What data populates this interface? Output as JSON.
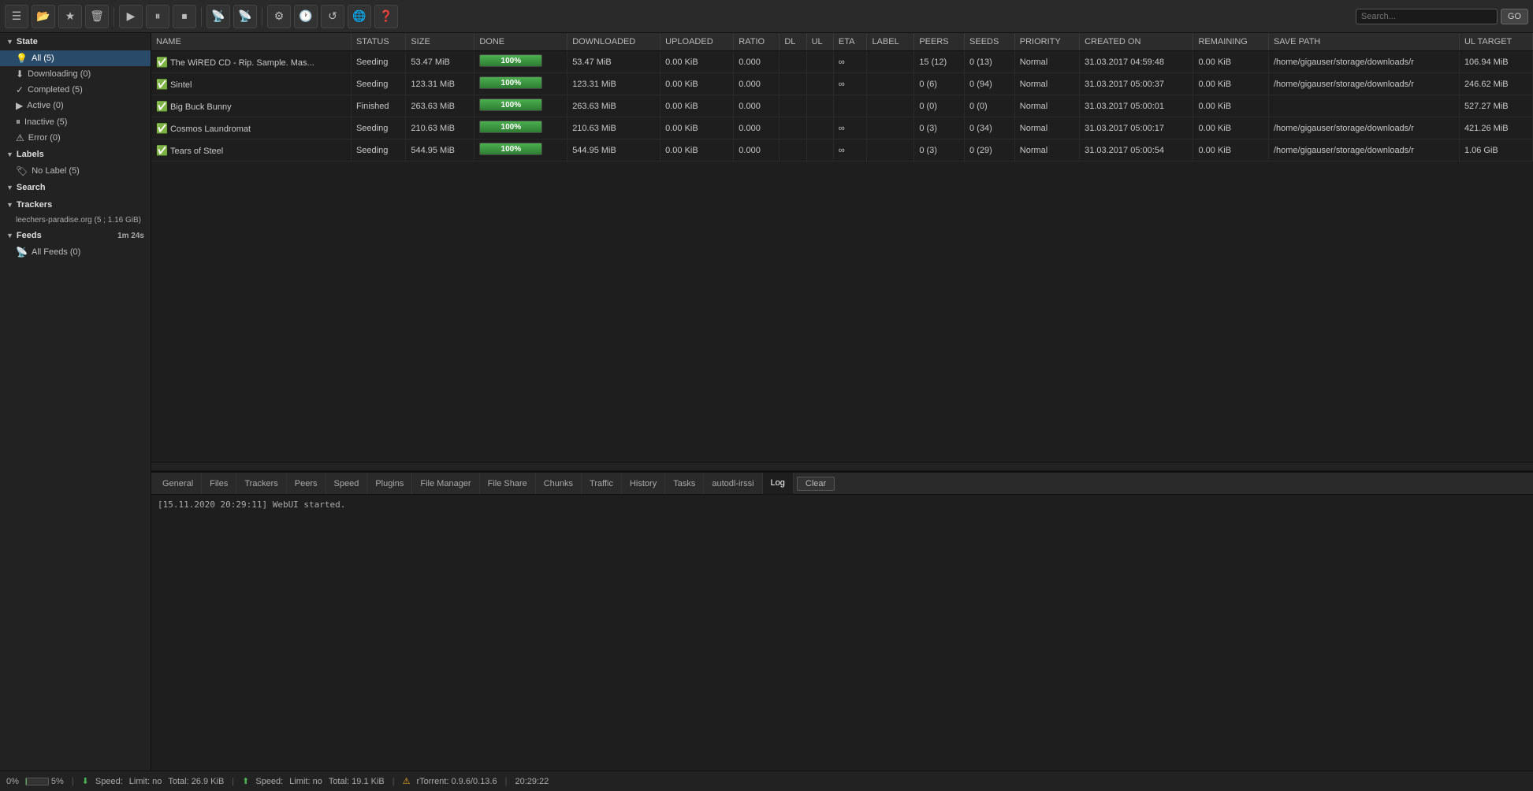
{
  "toolbar": {
    "buttons": [
      {
        "name": "menu-icon",
        "symbol": "☰"
      },
      {
        "name": "open-icon",
        "symbol": "📂"
      },
      {
        "name": "bookmark-icon",
        "symbol": "★"
      },
      {
        "name": "delete-icon",
        "symbol": "🗑"
      },
      {
        "name": "play-icon",
        "symbol": "▶"
      },
      {
        "name": "pause-icon",
        "symbol": "⏸"
      },
      {
        "name": "stop-icon",
        "symbol": "⏹"
      },
      {
        "name": "rss-icon",
        "symbol": "📡"
      },
      {
        "name": "rss2-icon",
        "symbol": "📡"
      },
      {
        "name": "settings-icon",
        "symbol": "⚙"
      },
      {
        "name": "clock-icon",
        "symbol": "🕐"
      },
      {
        "name": "refresh-icon",
        "symbol": "↺"
      },
      {
        "name": "network-icon",
        "symbol": "🌐"
      },
      {
        "name": "help-icon",
        "symbol": "❓"
      }
    ],
    "search_placeholder": "Search...",
    "go_label": "GO"
  },
  "sidebar": {
    "state_label": "State",
    "state_items": [
      {
        "label": "All (5)",
        "active": true,
        "icon": "💡"
      },
      {
        "label": "Downloading (0)",
        "icon": "⬇"
      },
      {
        "label": "Completed (5)",
        "icon": "✓"
      },
      {
        "label": "Active (0)",
        "icon": "▶"
      },
      {
        "label": "Inactive (5)",
        "icon": "⏸"
      },
      {
        "label": "Error (0)",
        "icon": "⚠"
      }
    ],
    "labels_label": "Labels",
    "label_items": [
      {
        "label": "No Label (5)",
        "icon": "🏷"
      }
    ],
    "search_label": "Search",
    "trackers_label": "Trackers",
    "tracker_items": [
      {
        "label": "leechers-paradise.org (5 ; 1.16 GiB)"
      }
    ],
    "feeds_label": "Feeds",
    "feeds_timer": "1m 24s",
    "feed_items": [
      {
        "label": "All Feeds (0)",
        "icon": "📡"
      }
    ]
  },
  "torrent_table": {
    "columns": [
      "NAME",
      "STATUS",
      "SIZE",
      "DONE",
      "DOWNLOADED",
      "UPLOADED",
      "RATIO",
      "DL",
      "UL",
      "ETA",
      "LABEL",
      "PEERS",
      "SEEDS",
      "PRIORITY",
      "CREATED ON",
      "REMAINING",
      "SAVE PATH",
      "UL TARGET"
    ],
    "rows": [
      {
        "icon": "✅",
        "name": "The WiRED CD - Rip. Sample. Mas...",
        "status": "Seeding",
        "status_class": "status-seeding",
        "size": "53.47 MiB",
        "done": 100,
        "downloaded": "53.47 MiB",
        "uploaded": "0.00 KiB",
        "ratio": "0.000",
        "dl": "",
        "ul": "",
        "eta": "∞",
        "label": "",
        "peers": "15 (12)",
        "seeds": "0 (13)",
        "priority": "Normal",
        "created_on": "31.03.2017 04:59:48",
        "remaining": "0.00 KiB",
        "save_path": "/home/gigauser/storage/downloads/r",
        "ul_target": "106.94 MiB"
      },
      {
        "icon": "✅",
        "name": "Sintel",
        "status": "Seeding",
        "status_class": "status-seeding",
        "size": "123.31 MiB",
        "done": 100,
        "downloaded": "123.31 MiB",
        "uploaded": "0.00 KiB",
        "ratio": "0.000",
        "dl": "",
        "ul": "",
        "eta": "∞",
        "label": "",
        "peers": "0 (6)",
        "seeds": "0 (94)",
        "priority": "Normal",
        "created_on": "31.03.2017 05:00:37",
        "remaining": "0.00 KiB",
        "save_path": "/home/gigauser/storage/downloads/r",
        "ul_target": "246.62 MiB"
      },
      {
        "icon": "✅",
        "name": "Big Buck Bunny",
        "status": "Finished",
        "status_class": "status-finished",
        "size": "263.63 MiB",
        "done": 100,
        "downloaded": "263.63 MiB",
        "uploaded": "0.00 KiB",
        "ratio": "0.000",
        "dl": "",
        "ul": "",
        "eta": "",
        "label": "",
        "peers": "0 (0)",
        "seeds": "0 (0)",
        "priority": "Normal",
        "created_on": "31.03.2017 05:00:01",
        "remaining": "0.00 KiB",
        "save_path": "",
        "ul_target": "527.27 MiB"
      },
      {
        "icon": "✅",
        "name": "Cosmos Laundromat",
        "status": "Seeding",
        "status_class": "status-seeding",
        "size": "210.63 MiB",
        "done": 100,
        "downloaded": "210.63 MiB",
        "uploaded": "0.00 KiB",
        "ratio": "0.000",
        "dl": "",
        "ul": "",
        "eta": "∞",
        "label": "",
        "peers": "0 (3)",
        "seeds": "0 (34)",
        "priority": "Normal",
        "created_on": "31.03.2017 05:00:17",
        "remaining": "0.00 KiB",
        "save_path": "/home/gigauser/storage/downloads/r",
        "ul_target": "421.26 MiB"
      },
      {
        "icon": "✅",
        "name": "Tears of Steel",
        "status": "Seeding",
        "status_class": "status-seeding",
        "size": "544.95 MiB",
        "done": 100,
        "downloaded": "544.95 MiB",
        "uploaded": "0.00 KiB",
        "ratio": "0.000",
        "dl": "",
        "ul": "",
        "eta": "∞",
        "label": "",
        "peers": "0 (3)",
        "seeds": "0 (29)",
        "priority": "Normal",
        "created_on": "31.03.2017 05:00:54",
        "remaining": "0.00 KiB",
        "save_path": "/home/gigauser/storage/downloads/r",
        "ul_target": "1.06 GiB"
      }
    ]
  },
  "bottom_tabs": {
    "tabs": [
      {
        "label": "General",
        "name": "tab-general"
      },
      {
        "label": "Files",
        "name": "tab-files"
      },
      {
        "label": "Trackers",
        "name": "tab-trackers"
      },
      {
        "label": "Peers",
        "name": "tab-peers"
      },
      {
        "label": "Speed",
        "name": "tab-speed"
      },
      {
        "label": "Plugins",
        "name": "tab-plugins"
      },
      {
        "label": "File Manager",
        "name": "tab-file-manager"
      },
      {
        "label": "File Share",
        "name": "tab-file-share"
      },
      {
        "label": "Chunks",
        "name": "tab-chunks"
      },
      {
        "label": "Traffic",
        "name": "tab-traffic"
      },
      {
        "label": "History",
        "name": "tab-history"
      },
      {
        "label": "Tasks",
        "name": "tab-tasks"
      },
      {
        "label": "autodl-irssi",
        "name": "tab-autodl"
      },
      {
        "label": "Log",
        "name": "tab-log",
        "active": true
      }
    ],
    "clear_label": "Clear",
    "log_line": "[15.11.2020 20:29:11] WebUI started."
  },
  "statusbar": {
    "disk_pct": "0%",
    "disk_mini_fill": 5,
    "disk_mini_label": "5%",
    "dl_label": "Speed:",
    "dl_limit": "Limit:  no",
    "dl_total": "Total:  26.9 KiB",
    "ul_label": "Speed:",
    "ul_limit": "Limit:  no",
    "ul_total": "Total:  19.1 KiB",
    "rtorrent_label": "rTorrent: 0.9.6/0.13.6",
    "time": "20:29:22"
  }
}
